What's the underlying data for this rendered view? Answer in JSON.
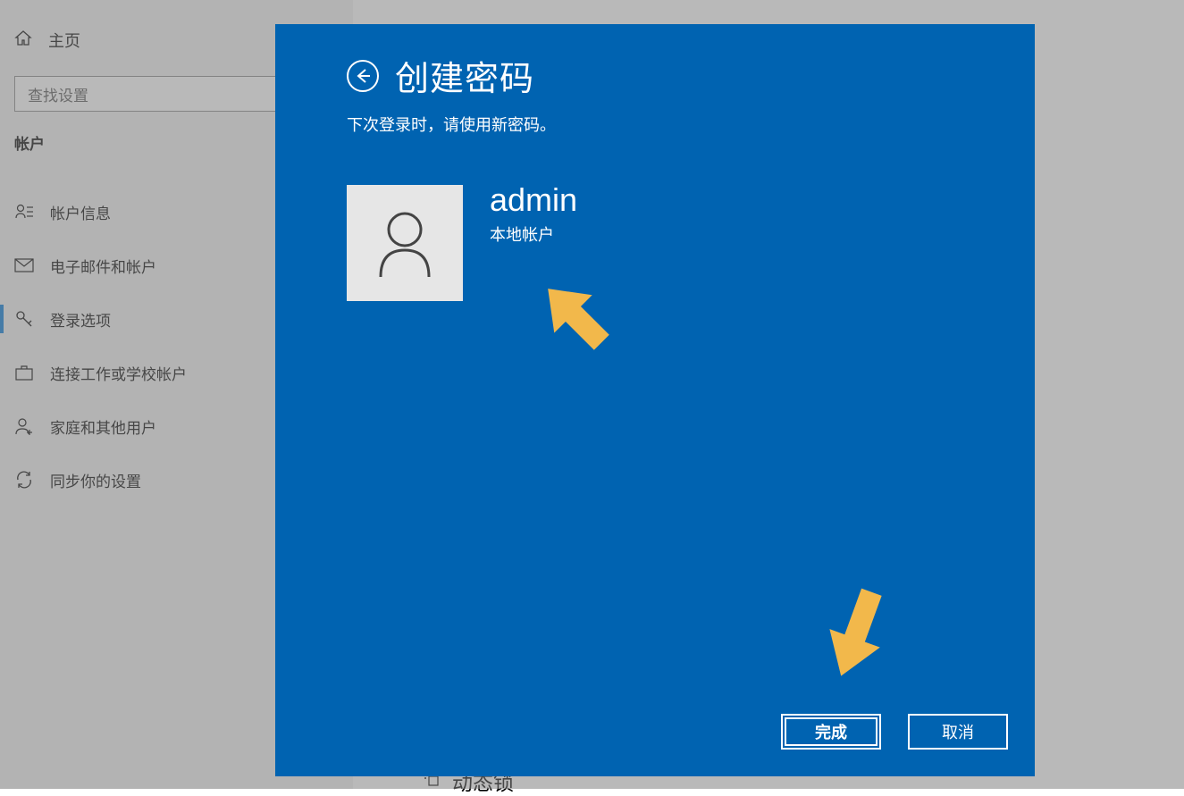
{
  "sidebar": {
    "home_label": "主页",
    "search_placeholder": "查找设置",
    "section_title": "帐户",
    "items": [
      {
        "label": "帐户信息"
      },
      {
        "label": "电子邮件和帐户"
      },
      {
        "label": "登录选项"
      },
      {
        "label": "连接工作或学校帐户"
      },
      {
        "label": "家庭和其他用户"
      },
      {
        "label": "同步你的设置"
      }
    ]
  },
  "dialog": {
    "title": "创建密码",
    "subtitle": "下次登录时，请使用新密码。",
    "user_name": "admin",
    "user_type": "本地帐户",
    "finish_label": "完成",
    "cancel_label": "取消"
  },
  "background": {
    "partial_item_label": "动态锁"
  },
  "colors": {
    "dialog_bg": "#0063b1",
    "arrow": "#f2b84b"
  }
}
